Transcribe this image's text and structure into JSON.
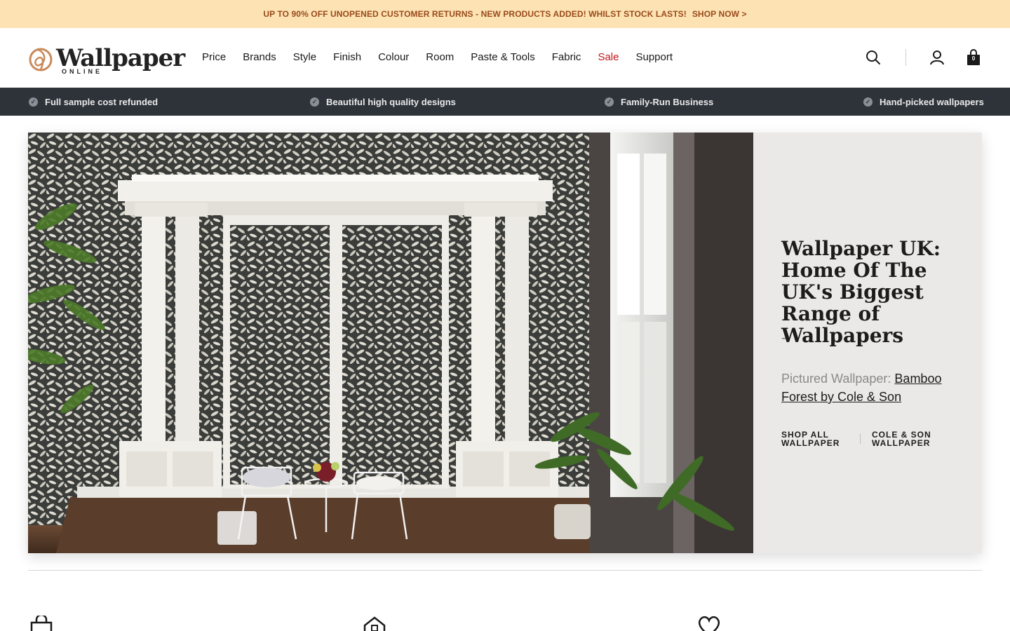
{
  "promo": {
    "message": "UP TO 90% OFF UNOPENED CUSTOMER RETURNS - NEW PRODUCTS ADDED! WHILST STOCK LASTS!",
    "cta": "SHOP NOW >"
  },
  "header": {
    "logo_main": "Wallpaper",
    "logo_sub": "ONLINE",
    "nav": [
      "Price",
      "Brands",
      "Style",
      "Finish",
      "Colour",
      "Room",
      "Paste & Tools",
      "Fabric",
      "Sale",
      "Support"
    ],
    "cart_count": "0",
    "icons": [
      "search-icon",
      "account-icon",
      "bag-icon"
    ]
  },
  "usp": {
    "items": [
      "Full sample cost refunded",
      "Beautiful high quality designs",
      "Family-Run Business",
      "Hand-picked wallpapers"
    ]
  },
  "hero": {
    "title": "Wallpaper UK: Home Of The UK's Biggest Range of Wallpapers",
    "dash": "-",
    "pictured_label": "Pictured Wallpaper:",
    "pictured_link": "Bamboo Forest by Cole & Son",
    "link_1": "SHOP ALL WALLPAPER",
    "link_2": "COLE & SON WALLPAPER"
  },
  "colors": {
    "promo_bg": "#fde2b3",
    "promo_text": "#9a4b1c",
    "usp_bg": "#2e333a",
    "sale": "#c0161c",
    "hero_panel_bg": "#ebe9e7"
  },
  "features": {
    "icons": [
      "bag-icon",
      "house-icon",
      "heart-icon"
    ]
  }
}
